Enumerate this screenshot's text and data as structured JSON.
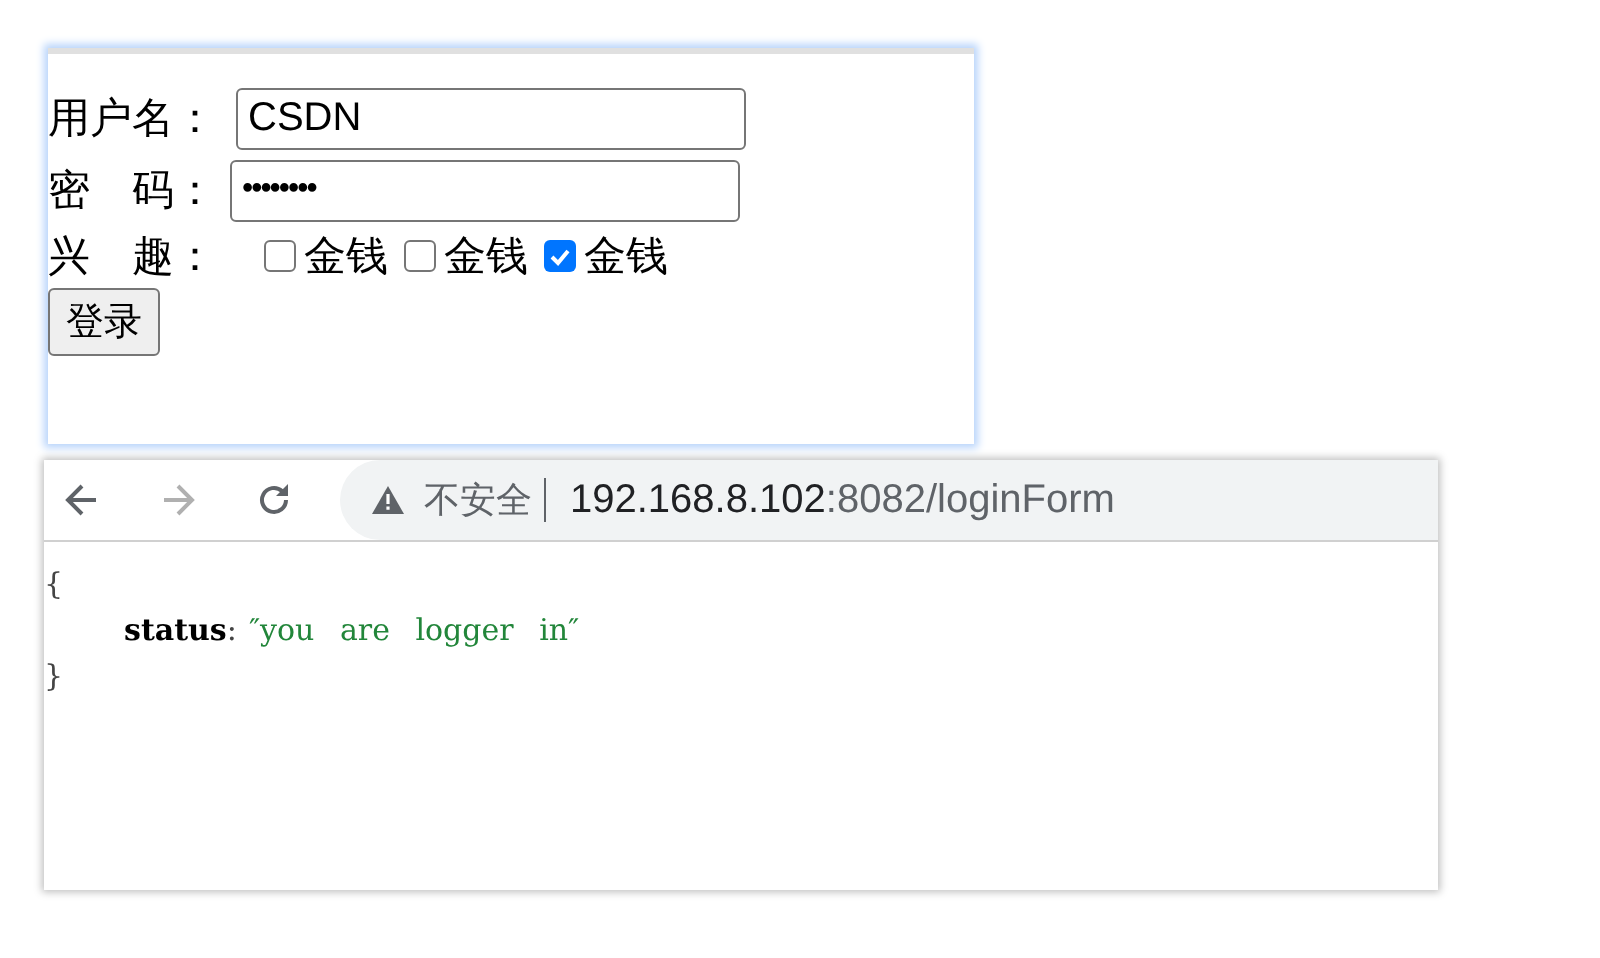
{
  "login_form": {
    "username": {
      "label": "用户名：",
      "value": "CSDN"
    },
    "password": {
      "label": "密　码：",
      "value": "••••••••"
    },
    "interests": {
      "label": "兴　趣：",
      "options": [
        {
          "label": "金钱",
          "checked": false
        },
        {
          "label": "金钱",
          "checked": false
        },
        {
          "label": "金钱",
          "checked": true
        }
      ]
    },
    "submit_button": "登录"
  },
  "browser": {
    "security_label": "不安全",
    "url_host": "192.168.8.102",
    "url_path": ":8082/loginForm",
    "response_lines": [
      {
        "kind": "brace",
        "text": "{"
      },
      {
        "kind": "pair",
        "key": "status",
        "sep": ":",
        "value": "″you are logger in″"
      },
      {
        "kind": "brace",
        "text": "}"
      }
    ]
  }
}
